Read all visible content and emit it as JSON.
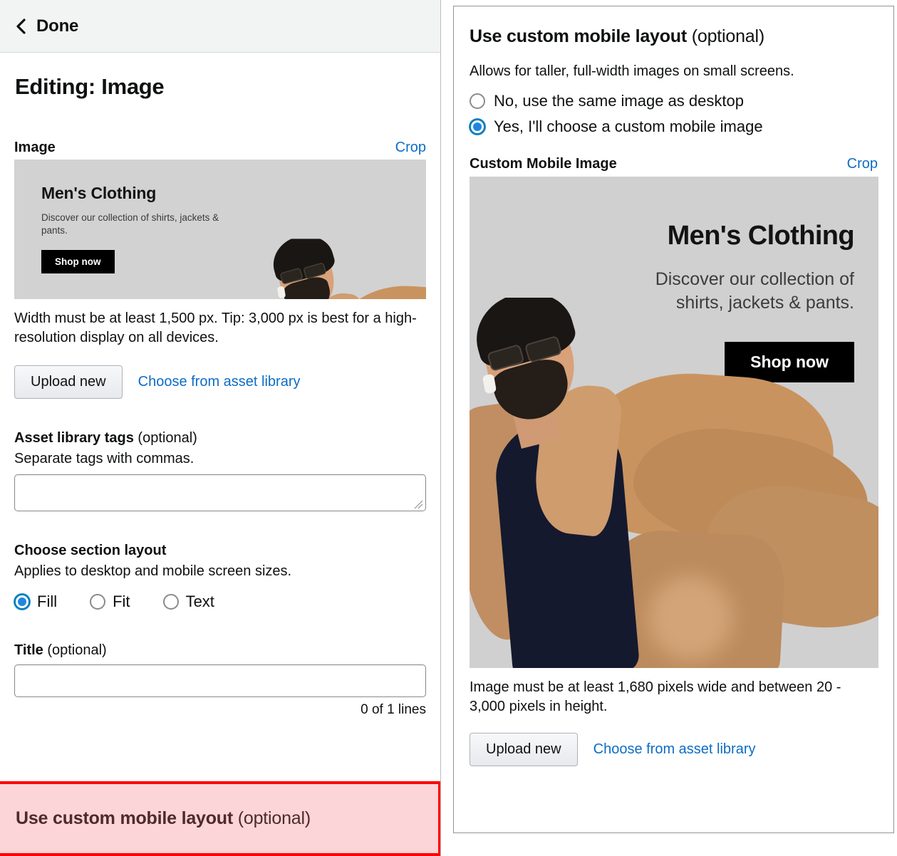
{
  "left_panel": {
    "header": {
      "back_icon": "chevron-left-icon",
      "done_label": "Done"
    },
    "page_title": "Editing: Image",
    "image_field": {
      "label": "Image",
      "crop_label": "Crop",
      "banner": {
        "heading": "Men's Clothing",
        "subtext": "Discover our collection of shirts, jackets & pants.",
        "cta_label": "Shop now",
        "background_color": "#d2d2d2"
      },
      "helper_text": "Width must be at least 1,500 px. Tip: 3,000 px is best for a high-resolution display on all devices.",
      "upload_label": "Upload new",
      "asset_library_label": "Choose from asset library"
    },
    "asset_tags": {
      "label": "Asset library tags",
      "optional": "(optional)",
      "description": "Separate tags with commas.",
      "value": "",
      "placeholder": ""
    },
    "section_layout": {
      "label": "Choose section layout",
      "description": "Applies to desktop and mobile screen sizes.",
      "options": [
        {
          "label": "Fill",
          "selected": true
        },
        {
          "label": "Fit",
          "selected": false
        },
        {
          "label": "Text",
          "selected": false
        }
      ]
    },
    "title_field": {
      "label": "Title",
      "optional": "(optional)",
      "value": "",
      "placeholder": "",
      "counter": "0 of 1 lines"
    },
    "callout": {
      "label": "Use custom mobile layout",
      "optional": "(optional)",
      "highlight_border_color": "#ff0000",
      "highlight_fill_color": "#fbd5d8"
    }
  },
  "right_panel": {
    "title": "Use custom mobile layout",
    "title_optional": "(optional)",
    "description": "Allows for taller, full-width images on small screens.",
    "mobile_layout_options": [
      {
        "label": "No, use the same image as desktop",
        "selected": false
      },
      {
        "label": "Yes, I'll choose a custom mobile image",
        "selected": true
      }
    ],
    "custom_image": {
      "label": "Custom Mobile Image",
      "crop_label": "Crop",
      "banner": {
        "heading": "Men's Clothing",
        "subtext": "Discover our collection of shirts, jackets & pants.",
        "cta_label": "Shop now",
        "background_color": "#d0d0d0"
      },
      "helper_text": "Image must be at least 1,680 pixels wide and between 20 - 3,000 pixels in height.",
      "upload_label": "Upload new",
      "asset_library_label": "Choose from asset library"
    }
  },
  "colors": {
    "link_blue": "#0d6dc4",
    "radio_accent": "#1f86e0",
    "text_primary": "#0f1111",
    "header_bg": "#f2f3f3"
  }
}
